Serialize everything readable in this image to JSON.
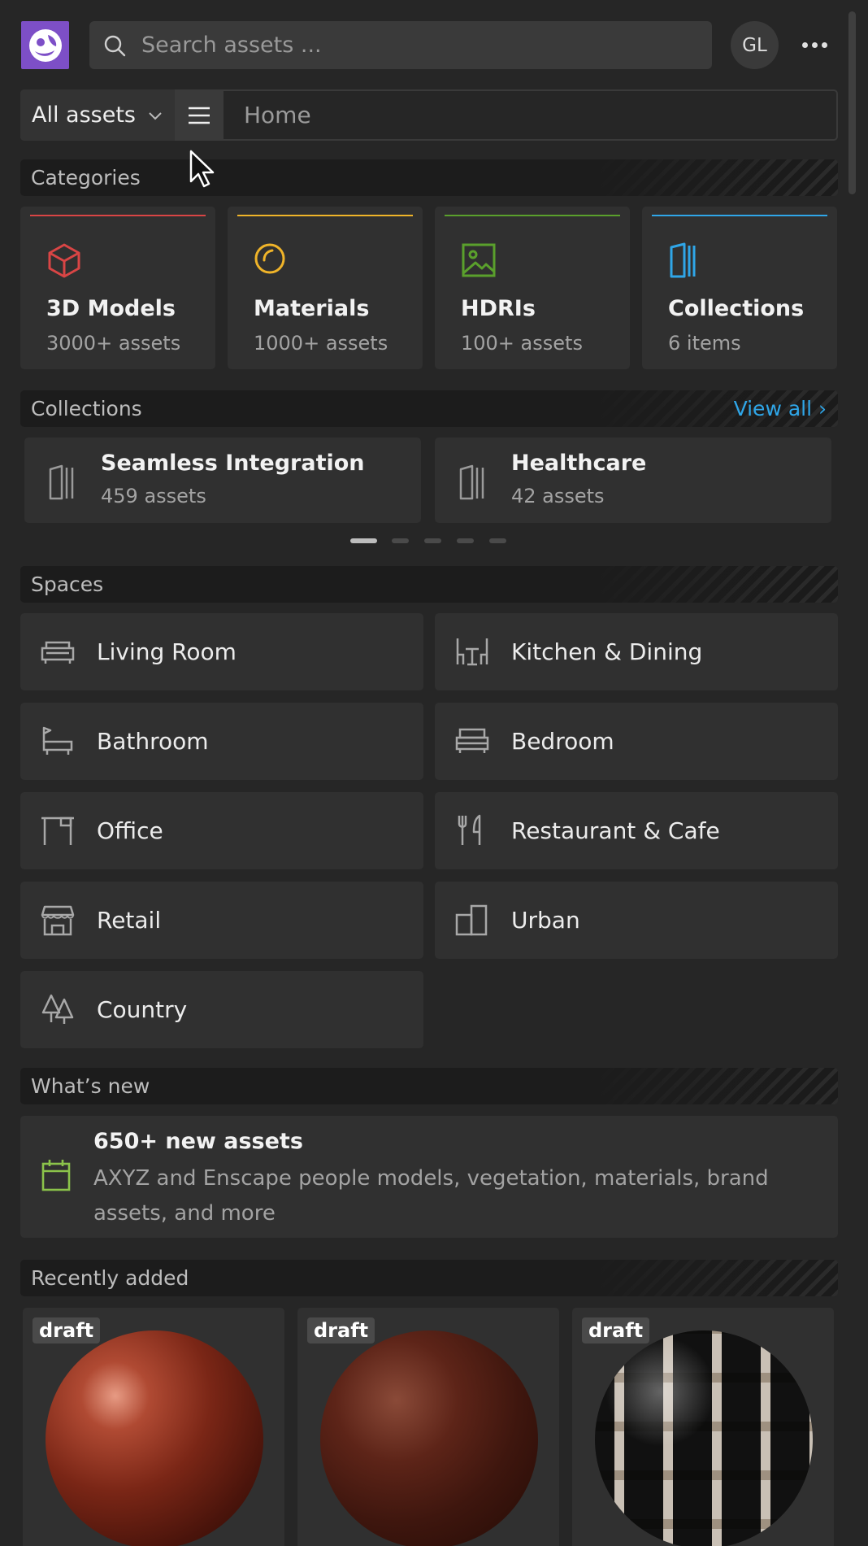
{
  "header": {
    "search_placeholder": "Search assets ...",
    "avatar_initials": "GL"
  },
  "nav": {
    "dropdown_label": "All assets",
    "breadcrumb": "Home"
  },
  "sections": {
    "categories": "Categories",
    "collections": "Collections",
    "view_all": "View all ›",
    "spaces": "Spaces",
    "whats_new": "What’s new",
    "recently_added": "Recently added"
  },
  "categories": [
    {
      "title": "3D Models",
      "sub": "3000+ assets",
      "color": "#d94545",
      "icon": "cube-icon"
    },
    {
      "title": "Materials",
      "sub": "1000+ assets",
      "color": "#f0b429",
      "icon": "material-icon"
    },
    {
      "title": "HDRIs",
      "sub": "100+ assets",
      "color": "#5aa02c",
      "icon": "image-icon"
    },
    {
      "title": "Collections",
      "sub": "6 items",
      "color": "#2fa6e8",
      "icon": "collection-icon"
    }
  ],
  "collections": [
    {
      "title": "Seamless Integration",
      "sub": "459 assets"
    },
    {
      "title": "Healthcare",
      "sub": "42 assets"
    }
  ],
  "carousel": {
    "pages": 5,
    "active": 1
  },
  "spaces": [
    {
      "label": "Living Room",
      "icon": "sofa-icon"
    },
    {
      "label": "Kitchen & Dining",
      "icon": "dining-icon"
    },
    {
      "label": "Bathroom",
      "icon": "bathtub-icon"
    },
    {
      "label": "Bedroom",
      "icon": "bed-icon"
    },
    {
      "label": "Office",
      "icon": "desk-icon"
    },
    {
      "label": "Restaurant & Cafe",
      "icon": "cutlery-icon"
    },
    {
      "label": "Retail",
      "icon": "store-icon"
    },
    {
      "label": "Urban",
      "icon": "buildings-icon"
    },
    {
      "label": "Country",
      "icon": "trees-icon"
    }
  ],
  "news": {
    "title": "650+ new assets",
    "desc": "AXYZ and Enscape people models, vegetation, materials, brand assets, and more"
  },
  "recent": [
    {
      "badge": "draft"
    },
    {
      "badge": "draft"
    },
    {
      "badge": "draft"
    }
  ],
  "accent_colors": {
    "logo": "#7d4fc7",
    "link": "#2fa6e8",
    "news_icon": "#8bc34a"
  }
}
